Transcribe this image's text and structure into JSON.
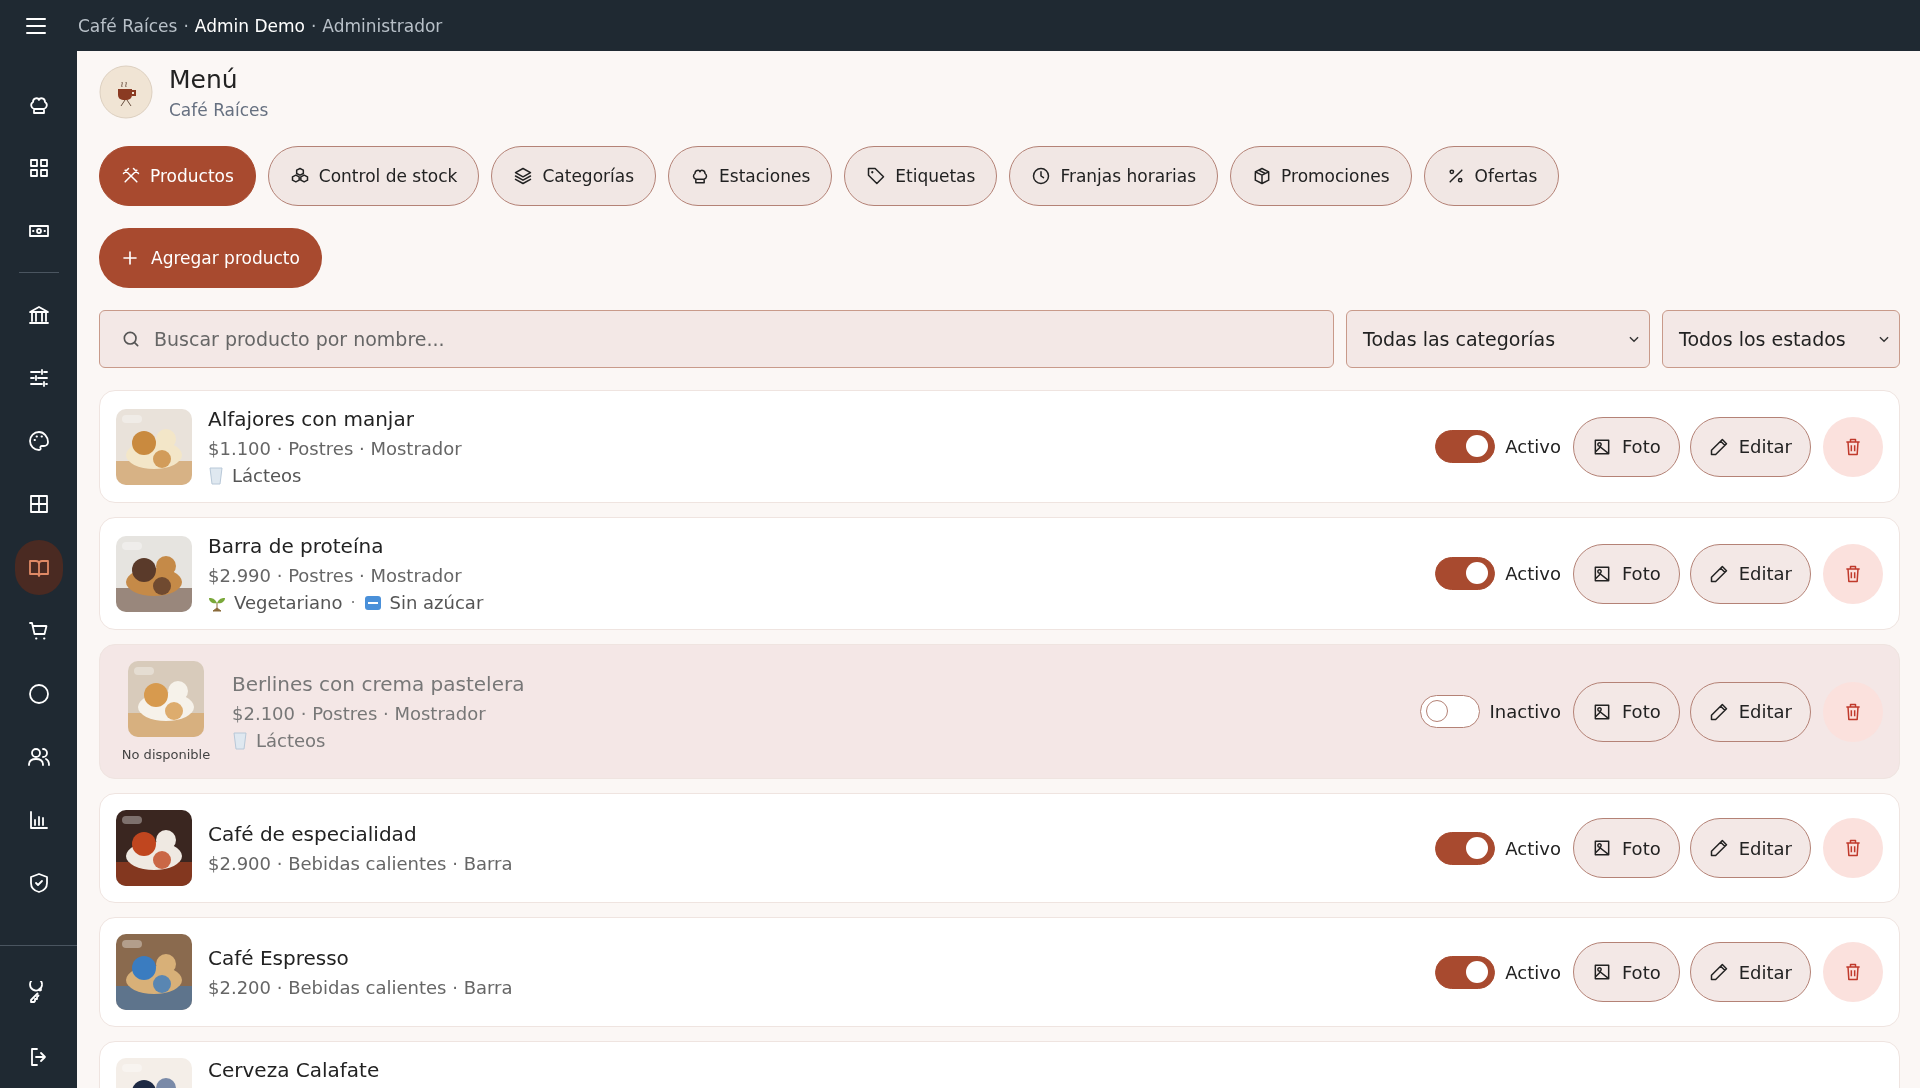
{
  "top_bar": {
    "crumbs": [
      {
        "text": "Café Raíces",
        "highlight": false
      },
      {
        "text": "·",
        "highlight": false
      },
      {
        "text": "Admin Demo",
        "highlight": true
      },
      {
        "text": "·",
        "highlight": false
      },
      {
        "text": "Administrador",
        "highlight": false
      }
    ]
  },
  "sidebar": {
    "groups": [
      {
        "items": [
          {
            "selected": false
          },
          {
            "selected": false
          },
          {
            "selected": false
          }
        ]
      },
      {
        "items": [
          {
            "selected": false
          },
          {
            "selected": false
          },
          {
            "selected": false
          },
          {
            "selected": false
          },
          {
            "selected": true
          },
          {
            "selected": false
          },
          {
            "selected": false
          },
          {
            "selected": false
          },
          {
            "selected": false
          },
          {
            "selected": false
          }
        ]
      },
      {
        "items": [
          {
            "selected": false
          },
          {
            "selected": false
          }
        ]
      }
    ]
  },
  "header": {
    "title": "Menú",
    "subtitle": "Café Raíces"
  },
  "tabs": [
    {
      "label": "Productos",
      "selected": true
    },
    {
      "label": "Control de stock",
      "selected": false
    },
    {
      "label": "Categorías",
      "selected": false
    },
    {
      "label": "Estaciones",
      "selected": false
    },
    {
      "label": "Etiquetas",
      "selected": false
    },
    {
      "label": "Franjas horarias",
      "selected": false
    },
    {
      "label": "Promociones",
      "selected": false
    },
    {
      "label": "Ofertas",
      "selected": false
    }
  ],
  "add_button": {
    "label": "Agregar producto"
  },
  "search": {
    "placeholder": "Buscar producto por nombre..."
  },
  "filters": [
    {
      "value": "Todas las categorías"
    },
    {
      "value": "Todos los estados"
    }
  ],
  "products": [
    {
      "name": "Alfajores con manjar",
      "meta": "$1.100 · Postres · Mostrador",
      "tags": [
        {
          "kind": "dairy",
          "label": "Lácteos"
        }
      ],
      "active": true,
      "status_label": "Activo",
      "photo_button": "Foto",
      "edit_button": "Editar"
    },
    {
      "name": "Barra de proteína",
      "meta": "$2.990 · Postres · Mostrador",
      "tags": [
        {
          "kind": "vegetarian",
          "label": "Vegetariano"
        },
        {
          "kind": "separator",
          "label": "·"
        },
        {
          "kind": "free",
          "label": "Sin azúcar"
        }
      ],
      "active": true,
      "status_label": "Activo",
      "photo_button": "Foto",
      "edit_button": "Editar"
    },
    {
      "name": "Berlines con crema pastelera",
      "meta": "$2.100 · Postres · Mostrador",
      "tags": [
        {
          "kind": "dairy",
          "label": "Lácteos"
        }
      ],
      "active": false,
      "status_label": "Inactivo",
      "unavailable_note": "No disponible",
      "photo_button": "Foto",
      "edit_button": "Editar"
    },
    {
      "name": "Café de especialidad",
      "meta": "$2.900 · Bebidas calientes · Barra",
      "active": true,
      "status_label": "Activo",
      "photo_button": "Foto",
      "edit_button": "Editar"
    },
    {
      "name": "Café Espresso",
      "meta": "$2.200 · Bebidas calientes · Barra",
      "active": true,
      "status_label": "Activo",
      "photo_button": "Foto",
      "edit_button": "Editar"
    },
    {
      "name": "Cerveza Calafate"
    }
  ]
}
